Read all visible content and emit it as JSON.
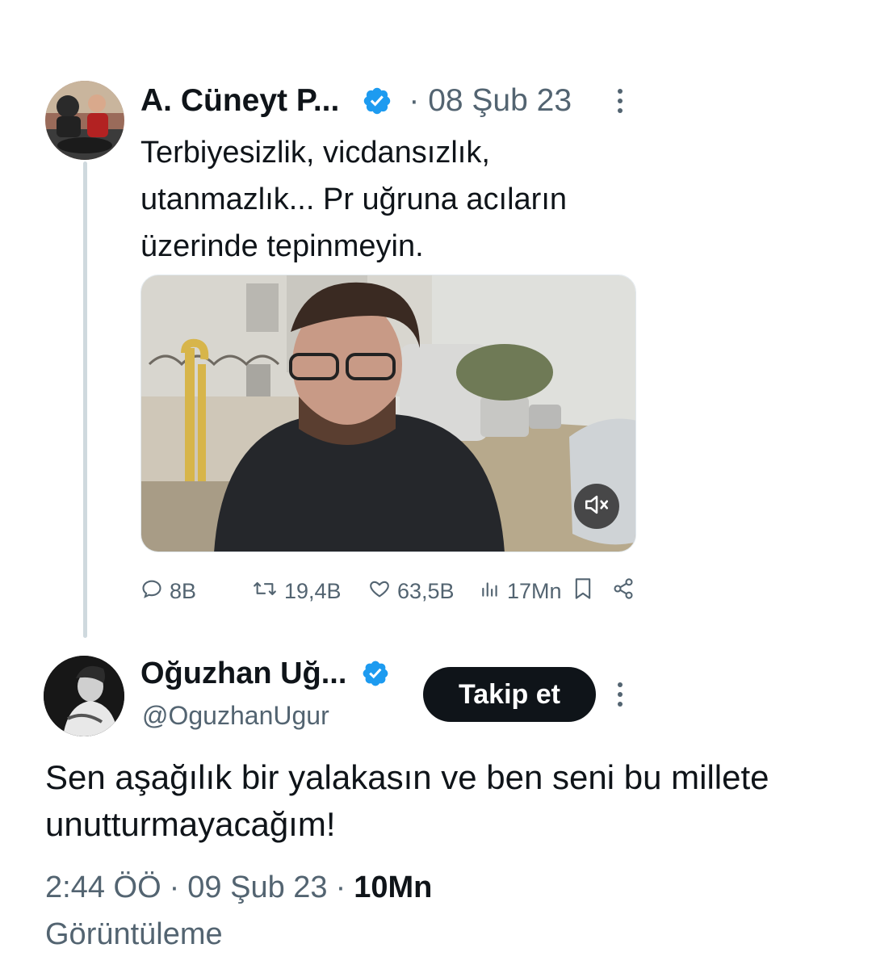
{
  "parent_tweet": {
    "display_name": "A. Cüneyt P...",
    "separator": "·",
    "date": "08 Şub 23",
    "text": "Terbiyesizlik, vicdansızlık, utanmazlık... Pr uğruna acıların üzerinde tepinmeyin.",
    "media": {
      "type": "video",
      "muted_icon": "speaker-muted-icon"
    },
    "stats": {
      "replies": "8B",
      "retweets": "19,4B",
      "likes": "63,5B",
      "views": "17Mn"
    }
  },
  "main_tweet": {
    "display_name": "Oğuzhan Uğ...",
    "handle": "@OguzhanUgur",
    "follow_label": "Takip et",
    "text": "Sen aşağılık bir yalakasın ve ben seni bu millete unutturmayacağım!",
    "time": "2:44 ÖÖ",
    "separator": "·",
    "date": "09 Şub 23",
    "views": "10Mn",
    "views_label": "Görüntüleme"
  },
  "colors": {
    "verified": "#1d9bf0",
    "secondary_text": "#536471",
    "primary_text": "#0f1419",
    "follow_button": "#0f1419",
    "thread_line": "#cfd9de"
  }
}
